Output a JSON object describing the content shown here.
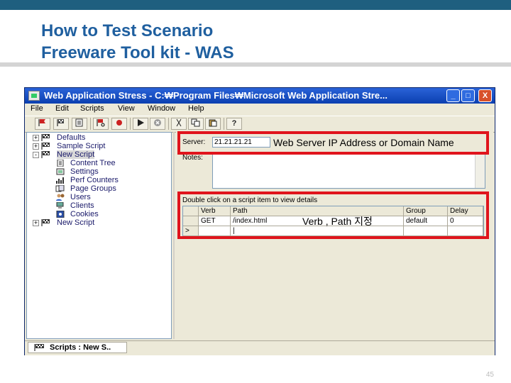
{
  "slide": {
    "title_line1": "How to Test Scenario",
    "title_line2": "Freeware Tool kit - WAS",
    "page_number": "45",
    "accent_color": "#1f5f7f",
    "title_color": "#1f5f9f",
    "highlight_color": "#e0141c"
  },
  "window": {
    "title": "Web Application Stress - C:₩Program Files₩Microsoft Web Application Stre...",
    "controls": {
      "minimize": "_",
      "maximize": "□",
      "close": "X"
    }
  },
  "menu": [
    "File",
    "Edit",
    "Scripts",
    "View",
    "Window",
    "Help"
  ],
  "toolbar": {
    "icons": [
      "flag-go-icon",
      "flag-new-icon",
      "script-icon",
      "scripts-cut-icon",
      "record-icon",
      "play-icon",
      "stop-icon",
      "cut-icon",
      "copy-icon",
      "paste-icon",
      "help-icon"
    ],
    "help_label": "?"
  },
  "tree": {
    "nodes": [
      {
        "label": "Defaults",
        "expander": "+"
      },
      {
        "label": "Sample Script",
        "expander": "+"
      },
      {
        "label": "New Script",
        "expander": "-"
      },
      {
        "label": "Content Tree"
      },
      {
        "label": "Settings"
      },
      {
        "label": "Perf Counters"
      },
      {
        "label": "Page Groups"
      },
      {
        "label": "Users"
      },
      {
        "label": "Clients"
      },
      {
        "label": "Cookies"
      },
      {
        "label": "New Script",
        "expander": "+"
      }
    ]
  },
  "panel": {
    "server_label": "Server:",
    "server_value": "21.21.21.21",
    "notes_label": "Notes:",
    "grid_caption": "Double click on a script item to view details",
    "columns": [
      "Verb",
      "Path",
      "Group",
      "Delay"
    ],
    "rows": [
      {
        "marker": "",
        "verb": "GET",
        "path": "/index.html",
        "group": "default",
        "delay": "0"
      },
      {
        "marker": ">",
        "verb": "",
        "path": "|",
        "group": "",
        "delay": ""
      }
    ]
  },
  "tab": {
    "label": "Scripts : New S.."
  },
  "callouts": {
    "server": "Web Server IP Address or Domain Name",
    "verb_path": "Verb , Path 지정"
  }
}
